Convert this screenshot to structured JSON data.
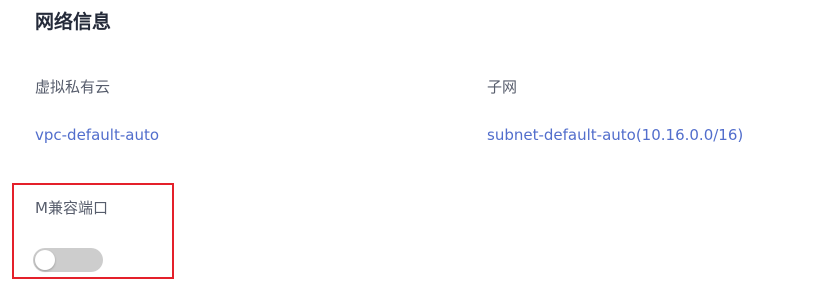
{
  "section": {
    "title": "网络信息"
  },
  "fields": {
    "vpc": {
      "label": "虚拟私有云",
      "value": "vpc-default-auto"
    },
    "subnet": {
      "label": "子网",
      "value": "subnet-default-auto(10.16.0.0/16)"
    },
    "m_port": {
      "label": "M兼容端口",
      "enabled": false
    }
  },
  "colors": {
    "title": "#252b3a",
    "label": "#575d6c",
    "link": "#526ecc",
    "highlight_border": "#e4202a",
    "toggle_off": "#cdcdcd"
  }
}
